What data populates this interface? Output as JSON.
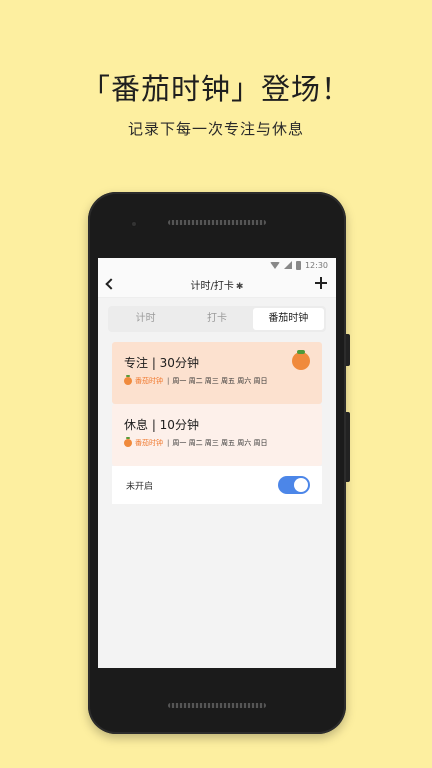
{
  "promo": {
    "headline": "「番茄时钟」登场！",
    "subline": "记录下每一次专注与休息"
  },
  "statusbar": {
    "time": "12:30"
  },
  "toolbar": {
    "title": "计时/打卡",
    "bluetooth_glyph": "✱"
  },
  "tabs": [
    {
      "label": "计时"
    },
    {
      "label": "打卡"
    },
    {
      "label": "番茄时钟"
    }
  ],
  "cards": [
    {
      "title": "专注 | 30分钟",
      "tag": "番茄时钟",
      "sep": "|",
      "days": "周一 周二 周三 周五 周六 周日"
    },
    {
      "title": "休息 | 10分钟",
      "tag": "番茄时钟",
      "sep": "|",
      "days": "周一 周二 周三 周五 周六 周日"
    }
  ],
  "toggle": {
    "label": "未开启"
  },
  "colors": {
    "background": "#FDEFA0",
    "focus_card": "#FCE1CF",
    "rest_card": "#FDF0EA",
    "accent": "#4C86E8",
    "tomato": "#F08A3C"
  }
}
